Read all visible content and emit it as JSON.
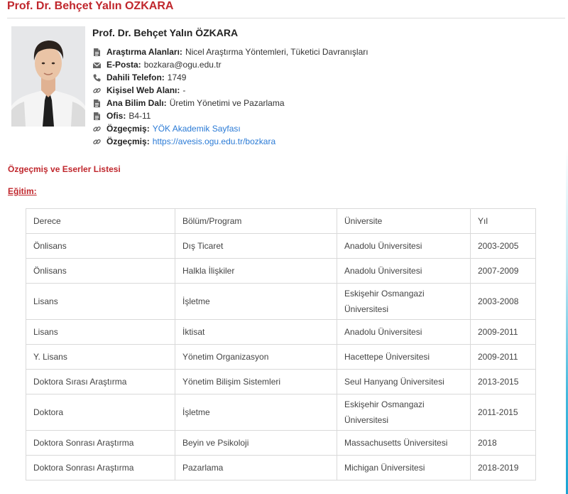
{
  "page": {
    "heading": "Prof. Dr. Behçet Yalın OZKARA"
  },
  "profile": {
    "name": "Prof. Dr. Behçet Yalın ÖZKARA",
    "rows": [
      {
        "icon": "document-icon",
        "label": "Araştırma Alanları:",
        "value": "Nicel Araştırma Yöntemleri, Tüketici Davranışları",
        "link": false
      },
      {
        "icon": "envelope-icon",
        "label": "E-Posta:",
        "value": "bozkara@ogu.edu.tr",
        "link": false
      },
      {
        "icon": "phone-icon",
        "label": "Dahili Telefon:",
        "value": "1749",
        "link": false
      },
      {
        "icon": "link-icon",
        "label": "Kişisel Web Alanı:",
        "value": "-",
        "link": false
      },
      {
        "icon": "document-icon",
        "label": "Ana Bilim Dalı:",
        "value": "Üretim Yönetimi ve Pazarlama",
        "link": false
      },
      {
        "icon": "document-icon",
        "label": "Ofis:",
        "value": "B4-11",
        "link": false
      },
      {
        "icon": "link-icon",
        "label": "Özgeçmiş:",
        "value": "YÖK Akademik Sayfası",
        "link": true
      },
      {
        "icon": "link-icon",
        "label": "Özgeçmiş:",
        "value": "https://avesis.ogu.edu.tr/bozkara",
        "link": true
      }
    ]
  },
  "cv_section_title": "Özgeçmiş ve Eserler Listesi",
  "education": {
    "title": "Eğitim:",
    "headers": [
      "Derece",
      "Bölüm/Program",
      "Üniversite",
      "Yıl"
    ],
    "rows": [
      [
        "Önlisans",
        "Dış Ticaret",
        "Anadolu Üniversitesi",
        "2003-2005"
      ],
      [
        "Önlisans",
        "Halkla İlişkiler",
        "Anadolu Üniversitesi",
        "2007-2009"
      ],
      [
        "Lisans",
        "İşletme",
        "Eskişehir Osmangazi Üniversitesi",
        "2003-2008"
      ],
      [
        "Lisans",
        "İktisat",
        "Anadolu Üniversitesi",
        "2009-2011"
      ],
      [
        "Y. Lisans",
        "Yönetim Organizasyon",
        "Hacettepe Üniversitesi",
        "2009-2011"
      ],
      [
        "Doktora Sırası Araştırma",
        "Yönetim Bilişim Sistemleri",
        "Seul Hanyang Üniversitesi",
        "2013-2015"
      ],
      [
        "Doktora",
        "İşletme",
        "Eskişehir Osmangazi Üniversitesi",
        "2011-2015"
      ],
      [
        "Doktora Sonrası Araştırma",
        "Beyin ve Psikoloji",
        "Massachusetts Üniversitesi",
        "2018"
      ],
      [
        "Doktora Sonrası Araştırma",
        "Pazarlama",
        "Michigan Üniversitesi",
        "2018-2019"
      ]
    ]
  }
}
